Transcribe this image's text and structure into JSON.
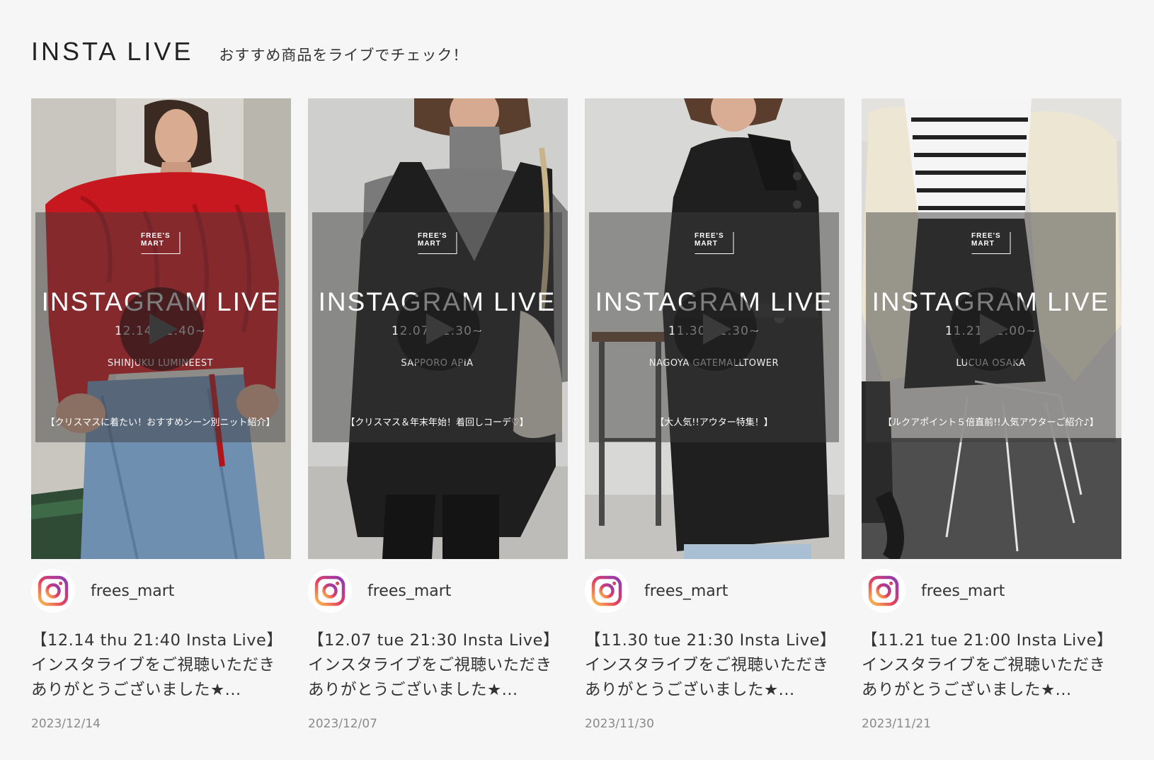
{
  "header": {
    "title": "INSTA LIVE",
    "subtitle": "おすすめ商品をライブでチェック！"
  },
  "cards": [
    {
      "thumb": {
        "brand": "FREE'S MART",
        "title": "INSTAGRAM LIVE",
        "time": "12.14    21:40~",
        "store": "SHINJUKU LUMINEEST",
        "topic": "【クリスマスに着たい！おすすめシーン別ニット紹介】"
      },
      "account": "frees_mart",
      "caption_line1": "【12.14 thu 21:40 Insta Live】",
      "caption_line2": "インスタライブをご視聴いただき",
      "caption_line3": "ありがとうございました★...",
      "date": "2023/12/14"
    },
    {
      "thumb": {
        "brand": "FREE'S MART",
        "title": "INSTAGRAM LIVE",
        "time": "12.07    21:30~",
        "store": "SAPPORO APIA",
        "topic": "【クリスマス＆年末年始！着回しコーデ♡】"
      },
      "account": "frees_mart",
      "caption_line1": "【12.07 tue 21:30 Insta Live】",
      "caption_line2": "インスタライブをご視聴いただき",
      "caption_line3": "ありがとうございました★...",
      "date": "2023/12/07"
    },
    {
      "thumb": {
        "brand": "FREE'S MART",
        "title": "INSTAGRAM LIVE",
        "time": "11.30    21:30~",
        "store": "NAGOYA GATEMALLTOWER",
        "topic": "【大人気!!アウター特集！】"
      },
      "account": "frees_mart",
      "caption_line1": "【11.30 tue 21:30 Insta Live】",
      "caption_line2": "インスタライブをご視聴いただき",
      "caption_line3": "ありがとうございました★...",
      "date": "2023/11/30"
    },
    {
      "thumb": {
        "brand": "FREE'S MART",
        "title": "INSTAGRAM LIVE",
        "time": "11.21    21:00~",
        "store": "LUCUA OSAKA",
        "topic": "【ルクアポイント５倍直前!!人気アウターご紹介♪】"
      },
      "account": "frees_mart",
      "caption_line1": "【11.21 tue 21:00 Insta Live】",
      "caption_line2": "インスタライブをご視聴いただき",
      "caption_line3": "ありがとうございました★...",
      "date": "2023/11/21"
    }
  ],
  "colors": {
    "background": "#f6f6f6",
    "text": "#333333",
    "date": "#8a8a8a"
  },
  "icons": {
    "account": "instagram-icon",
    "play": "play-icon"
  }
}
